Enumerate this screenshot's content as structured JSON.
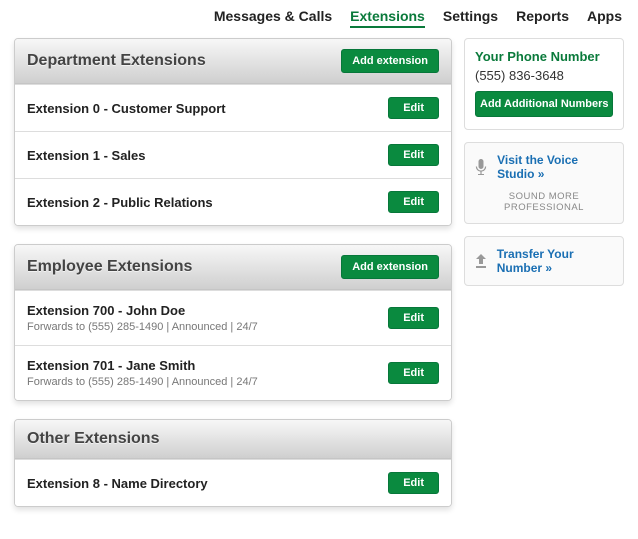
{
  "nav": {
    "items": [
      "Messages & Calls",
      "Extensions",
      "Settings",
      "Reports",
      "Apps"
    ],
    "activeIndex": 1
  },
  "sections": {
    "department": {
      "title": "Department Extensions",
      "addLabel": "Add extension",
      "rows": [
        {
          "title": "Extension 0 - Customer Support",
          "edit": "Edit"
        },
        {
          "title": "Extension 1 - Sales",
          "edit": "Edit"
        },
        {
          "title": "Extension 2 - Public Relations",
          "edit": "Edit"
        }
      ]
    },
    "employee": {
      "title": "Employee Extensions",
      "addLabel": "Add extension",
      "rows": [
        {
          "title": "Extension 700 - John Doe",
          "sub": "Forwards to (555) 285-1490 | Announced | 24/7",
          "edit": "Edit"
        },
        {
          "title": "Extension 701 - Jane Smith",
          "sub": "Forwards to (555) 285-1490 | Announced | 24/7",
          "edit": "Edit"
        }
      ]
    },
    "other": {
      "title": "Other Extensions",
      "rows": [
        {
          "title": "Extension 8 - Name Directory",
          "edit": "Edit"
        }
      ]
    }
  },
  "sidebar": {
    "phoneLabel": "Your Phone Number",
    "phone": "(555) 836-3648",
    "addNumbers": "Add Additional Numbers",
    "voiceStudio": "Visit the Voice Studio »",
    "voiceCaption": "SOUND MORE PROFESSIONAL",
    "transfer": "Transfer Your Number »"
  }
}
